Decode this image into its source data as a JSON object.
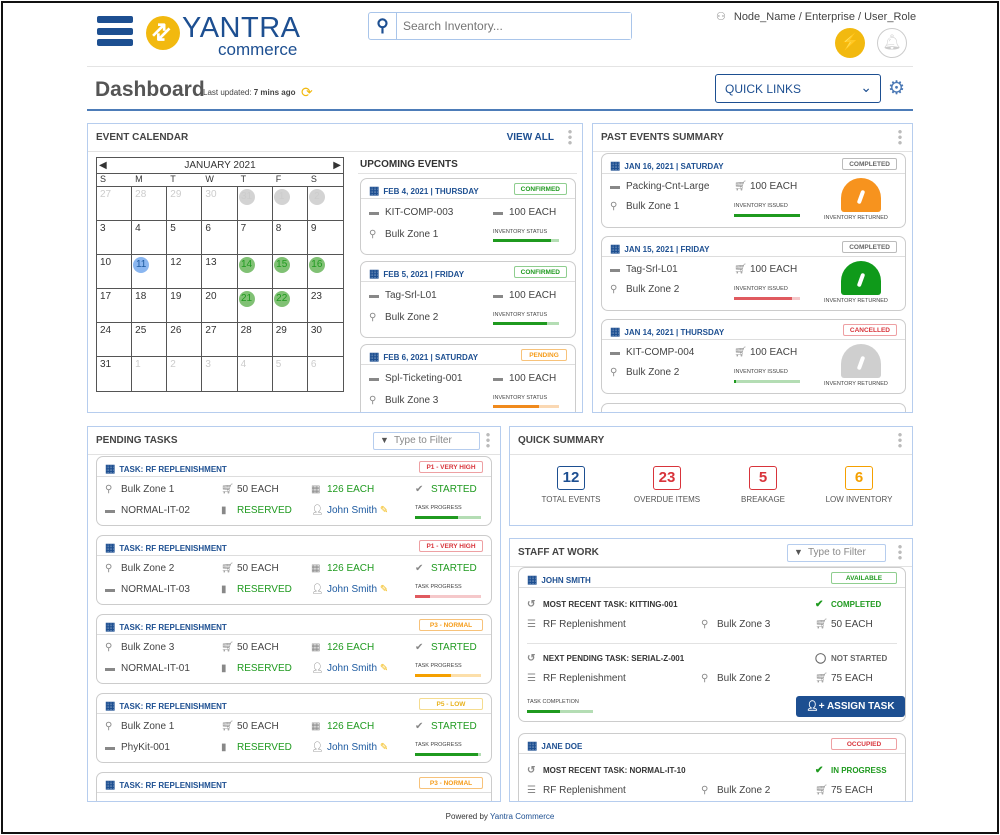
{
  "header": {
    "logo_text": "YANTRA",
    "logo_sub": "commerce",
    "search_placeholder": "Search Inventory...",
    "node_path": "Node_Name / Enterprise / User_Role"
  },
  "page": {
    "title": "Dashboard",
    "last_updated_label": "Last updated:",
    "last_updated_value": "7 mins ago",
    "quick_links": "QUICK LINKS"
  },
  "calendar_panel": {
    "title": "EVENT CALENDAR",
    "view_all": "VIEW ALL",
    "month": "JANUARY 2021",
    "weekdays": [
      "S",
      "M",
      "T",
      "W",
      "T",
      "F",
      "S"
    ],
    "days": [
      {
        "d": "27",
        "muted": true
      },
      {
        "d": "28",
        "muted": true
      },
      {
        "d": "29",
        "muted": true
      },
      {
        "d": "30",
        "muted": true
      },
      {
        "d": "31",
        "muted": true,
        "mark": "gray"
      },
      {
        "d": "1",
        "muted": true,
        "mark": "gray"
      },
      {
        "d": "2",
        "muted": true,
        "mark": "gray"
      },
      {
        "d": "3"
      },
      {
        "d": "4"
      },
      {
        "d": "5"
      },
      {
        "d": "6"
      },
      {
        "d": "7"
      },
      {
        "d": "8"
      },
      {
        "d": "9"
      },
      {
        "d": "10"
      },
      {
        "d": "11",
        "mark": "blue"
      },
      {
        "d": "12"
      },
      {
        "d": "13"
      },
      {
        "d": "14",
        "mark": "green"
      },
      {
        "d": "15",
        "mark": "green"
      },
      {
        "d": "16",
        "mark": "green"
      },
      {
        "d": "17"
      },
      {
        "d": "18"
      },
      {
        "d": "19"
      },
      {
        "d": "20"
      },
      {
        "d": "21",
        "mark": "green"
      },
      {
        "d": "22",
        "mark": "green"
      },
      {
        "d": "23"
      },
      {
        "d": "24"
      },
      {
        "d": "25"
      },
      {
        "d": "26"
      },
      {
        "d": "27"
      },
      {
        "d": "28"
      },
      {
        "d": "29"
      },
      {
        "d": "30"
      },
      {
        "d": "31"
      },
      {
        "d": "1",
        "muted": true
      },
      {
        "d": "2",
        "muted": true
      },
      {
        "d": "3",
        "muted": true
      },
      {
        "d": "4",
        "muted": true
      },
      {
        "d": "5",
        "muted": true
      },
      {
        "d": "6",
        "muted": true
      }
    ],
    "upcoming_title": "UPCOMING EVENTS",
    "upcoming": [
      {
        "date": "FEB 4, 2021 | THURSDAY",
        "status": "CONFIRMED",
        "status_color": "green",
        "item": "KIT-COMP-003",
        "qty": "100 EACH",
        "location": "Bulk Zone 1",
        "bar_label": "INVENTORY STATUS",
        "progress": 0.88,
        "bar_color": "#1f9a1f"
      },
      {
        "date": "FEB 5, 2021 | FRIDAY",
        "status": "CONFIRMED",
        "status_color": "green",
        "item": "Tag-Srl-L01",
        "qty": "100 EACH",
        "location": "Bulk Zone 2",
        "bar_label": "INVENTORY STATUS",
        "progress": 0.82,
        "bar_color": "#1f9a1f"
      },
      {
        "date": "FEB 6, 2021 | SATURDAY",
        "status": "PENDING",
        "status_color": "orange",
        "item": "Spl-Ticketing-001",
        "qty": "100 EACH",
        "location": "Bulk Zone 3",
        "bar_label": "INVENTORY STATUS",
        "progress": 0.7,
        "bar_color": "#f08a1c"
      }
    ]
  },
  "past_panel": {
    "title": "PAST EVENTS SUMMARY",
    "events": [
      {
        "date": "JAN 16, 2021 | SATURDAY",
        "status": "COMPLETED",
        "status_color": "gray",
        "item": "Packing-Cnt-Large",
        "qty": "100 EACH",
        "location": "Bulk Zone 1",
        "bar_label": "INVENTORY ISSUED",
        "progress": 1.0,
        "bar_color": "#1f9a1f",
        "gauge_label": "INVENTORY RETURNED",
        "gauge_color": "#f7931e"
      },
      {
        "date": "JAN 15, 2021 | FRIDAY",
        "status": "COMPLETED",
        "status_color": "gray",
        "item": "Tag-Srl-L01",
        "qty": "100 EACH",
        "location": "Bulk Zone 2",
        "bar_label": "INVENTORY ISSUED",
        "progress": 0.88,
        "bar_color": "#e05a5f",
        "gauge_label": "INVENTORY RETURNED",
        "gauge_color": "#0f9a1a"
      },
      {
        "date": "JAN 14, 2021 | THURSDAY",
        "status": "CANCELLED",
        "status_color": "red",
        "item": "KIT-COMP-004",
        "qty": "100 EACH",
        "location": "Bulk Zone 2",
        "bar_label": "INVENTORY ISSUED",
        "progress": 0.03,
        "bar_color": "#1f9a1f",
        "gauge_label": "INVENTORY RETURNED",
        "gauge_color": "#cfcfcf"
      }
    ]
  },
  "tasks_panel": {
    "title": "PENDING TASKS",
    "filter_placeholder": "Type to Filter",
    "tasks": [
      {
        "title": "TASK: RF REPLENISHMENT",
        "priority": "P1 - VERY HIGH",
        "priority_color": "red",
        "location": "Bulk Zone 1",
        "qty": "50 EACH",
        "avail": "126 EACH",
        "status": "STARTED",
        "item": "NORMAL-IT-02",
        "reserve": "RESERVED",
        "assignee": "John Smith",
        "bar_label": "TASK PROGRESS",
        "progress": 0.65,
        "bar_color": "#1f9a1f"
      },
      {
        "title": "TASK: RF REPLENISHMENT",
        "priority": "P1 - VERY HIGH",
        "priority_color": "red",
        "location": "Bulk Zone 2",
        "qty": "50 EACH",
        "avail": "126 EACH",
        "status": "STARTED",
        "item": "NORMAL-IT-03",
        "reserve": "RESERVED",
        "assignee": "John Smith",
        "bar_label": "TASK PROGRESS",
        "progress": 0.22,
        "bar_color": "#e05a5f"
      },
      {
        "title": "TASK: RF REPLENISHMENT",
        "priority": "P3 - NORMAL",
        "priority_color": "orange",
        "location": "Bulk Zone 3",
        "qty": "50 EACH",
        "avail": "126 EACH",
        "status": "STARTED",
        "item": "NORMAL-IT-01",
        "reserve": "RESERVED",
        "assignee": "John Smith",
        "bar_label": "TASK PROGRESS",
        "progress": 0.55,
        "bar_color": "#f5a000"
      },
      {
        "title": "TASK: RF REPLENISHMENT",
        "priority": "P5 - LOW",
        "priority_color": "yellow",
        "location": "Bulk Zone 1",
        "qty": "50 EACH",
        "avail": "126 EACH",
        "status": "STARTED",
        "item": "PhyKit-001",
        "reserve": "RESERVED",
        "assignee": "John Smith",
        "bar_label": "TASK PROGRESS",
        "progress": 0.95,
        "bar_color": "#1f9a1f"
      },
      {
        "title": "TASK: RF REPLENISHMENT",
        "priority": "P3 - NORMAL",
        "priority_color": "orange"
      }
    ]
  },
  "summary_panel": {
    "title": "QUICK SUMMARY",
    "items": [
      {
        "value": "12",
        "label": "TOTAL EVENTS",
        "color": "#1d4f91"
      },
      {
        "value": "23",
        "label": "OVERDUE ITEMS",
        "color": "#d8343b"
      },
      {
        "value": "5",
        "label": "BREAKAGE",
        "color": "#d8343b"
      },
      {
        "value": "6",
        "label": "LOW INVENTORY",
        "color": "#f5a000"
      }
    ]
  },
  "staff_panel": {
    "title": "STAFF AT WORK",
    "filter_placeholder": "Type to Filter",
    "john": {
      "name": "JOHN SMITH",
      "status": "AVAILABLE",
      "recent": "MOST RECENT TASK: KITTING-001",
      "recent_status": "COMPLETED",
      "recent_type": "RF Replenishment",
      "recent_loc": "Bulk Zone 3",
      "recent_qty": "50 EACH",
      "next": "NEXT PENDING TASK: SERIAL-Z-001",
      "next_status": "NOT STARTED",
      "next_type": "RF Replenishment",
      "next_loc": "Bulk Zone 2",
      "next_qty": "75 EACH",
      "bar_label": "TASK COMPLETION",
      "progress": 0.5,
      "assign": "ASSIGN TASK"
    },
    "jane": {
      "name": "JANE DOE",
      "status": "OCCUPIED",
      "recent": "MOST RECENT TASK: NORMAL-IT-10",
      "recent_status": "IN PROGRESS",
      "recent_type": "RF Replenishment",
      "recent_loc": "Bulk Zone 2",
      "recent_qty": "75 EACH"
    }
  },
  "footer": {
    "prefix": "Powered by",
    "link": "Yantra Commerce"
  }
}
